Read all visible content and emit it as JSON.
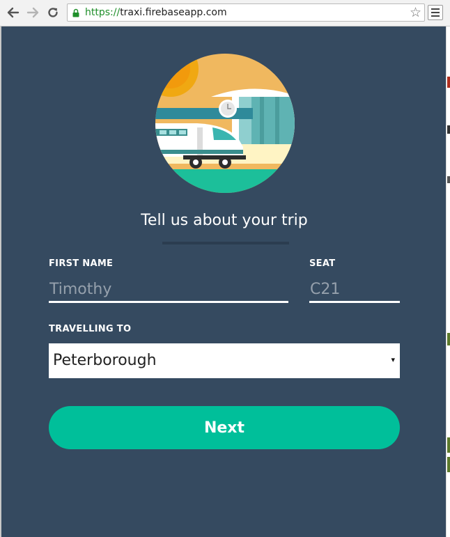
{
  "browser": {
    "back_icon": "back-arrow-icon",
    "forward_icon": "forward-arrow-icon",
    "reload_icon": "reload-icon",
    "url_scheme": "https://",
    "url_host": "traxi.firebaseapp.com",
    "bookmark_icon": "star-icon",
    "menu_icon": "hamburger-menu-icon"
  },
  "app": {
    "hero_illustration": "train-station-illustration",
    "heading": "Tell us about your trip",
    "first_name": {
      "label": "FIRST NAME",
      "placeholder": "Timothy",
      "value": ""
    },
    "seat": {
      "label": "SEAT",
      "placeholder": "C21",
      "value": ""
    },
    "destination": {
      "label": "TRAVELLING TO",
      "selected": "Peterborough",
      "caret": "▾"
    },
    "next_label": "Next"
  },
  "colors": {
    "background": "#354a60",
    "accent": "#00bf9a",
    "text": "#ffffff",
    "placeholder": "#95a0ac"
  }
}
